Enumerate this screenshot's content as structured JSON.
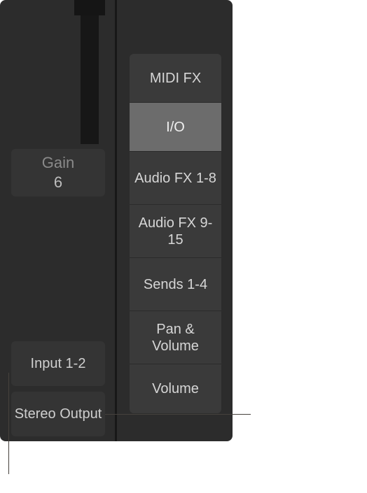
{
  "channel": {
    "gain": {
      "label": "Gain",
      "value": "6"
    },
    "input": {
      "label": "Input 1-2"
    },
    "output": {
      "label": "Stereo Output"
    }
  },
  "menu": {
    "items": [
      {
        "label": "MIDI FX",
        "selected": false,
        "lines": 1
      },
      {
        "label": "I/O",
        "selected": true,
        "lines": 1
      },
      {
        "label": "Audio FX 1-8",
        "selected": false,
        "lines": 2
      },
      {
        "label": "Audio FX 9-15",
        "selected": false,
        "lines": 2
      },
      {
        "label": "Sends 1-4",
        "selected": false,
        "lines": 2
      },
      {
        "label": "Pan & Volume",
        "selected": false,
        "lines": 2
      },
      {
        "label": "Volume",
        "selected": false,
        "lines": 1
      }
    ]
  }
}
